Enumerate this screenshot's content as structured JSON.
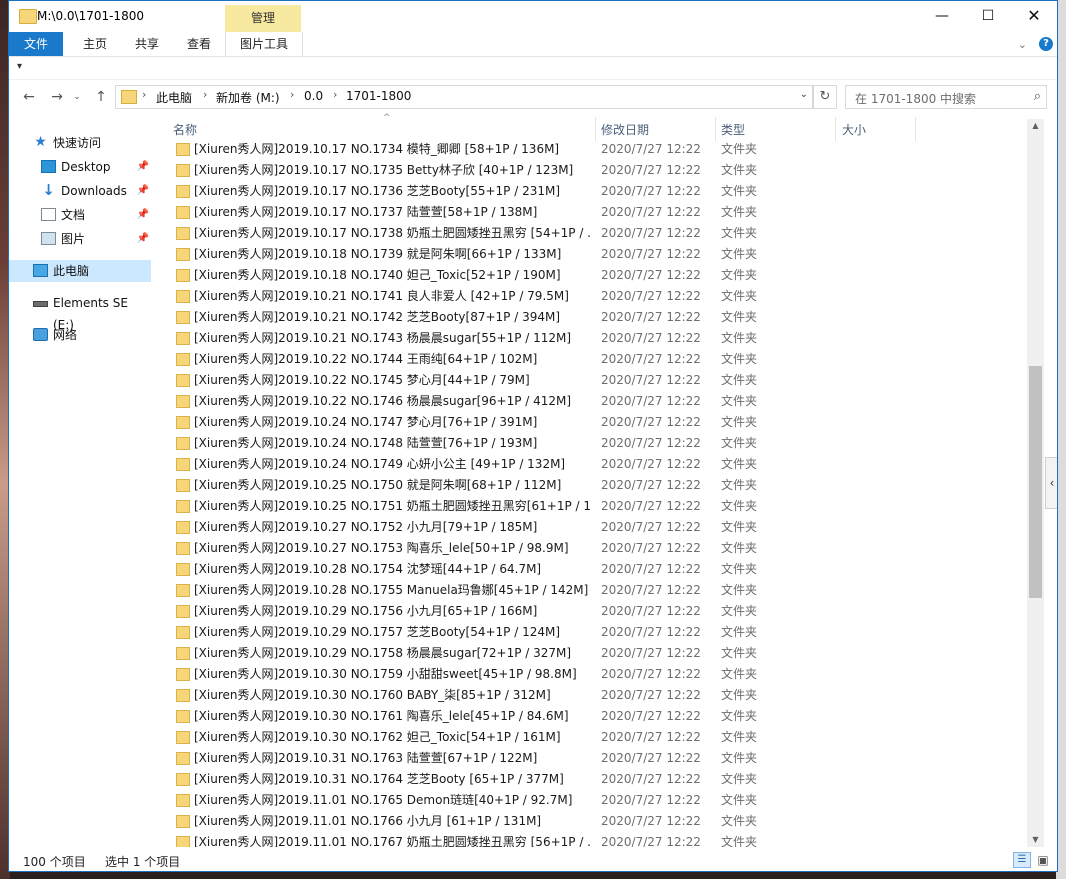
{
  "window": {
    "title": "M:\\0.0\\1701-1800",
    "manage_tab": "管理",
    "controls": {
      "minimize": "—",
      "maximize": "☐",
      "close": "✕"
    }
  },
  "ribbon": {
    "tabs": {
      "file": "文件",
      "home": "主页",
      "share": "共享",
      "view": "查看",
      "picture_tools": "图片工具"
    },
    "collapse_glyph": "⌄",
    "help": "?"
  },
  "qat": {
    "arrow": "▾"
  },
  "address": {
    "back": "←",
    "forward": "→",
    "recent": "⌄",
    "up": "↑",
    "crumbs": [
      "此电脑",
      "新加卷 (M:)",
      "0.0",
      "1701-1800"
    ],
    "separator": "›",
    "dropdown": "⌄",
    "refresh": "↻"
  },
  "search": {
    "placeholder": "在 1701-1800 中搜索",
    "icon": "search-icon"
  },
  "navpane": {
    "quick_access": "快速访问",
    "desktop": "Desktop",
    "downloads": "Downloads",
    "documents": "文档",
    "pictures": "图片",
    "this_pc": "此电脑",
    "drive": "Elements SE (E:)",
    "network": "网络",
    "pin": "📌"
  },
  "columns": {
    "name": "名称",
    "date": "修改日期",
    "type": "类型",
    "size": "大小",
    "sort_glyph": "^"
  },
  "files": [
    {
      "name": "[Xiuren秀人网]2019.10.17 NO.1734 模特_卿卿 [58+1P / 136M]",
      "date": "2020/7/27 12:22",
      "type": "文件夹"
    },
    {
      "name": "[Xiuren秀人网]2019.10.17 NO.1735 Betty林子欣 [40+1P / 123M]",
      "date": "2020/7/27 12:22",
      "type": "文件夹"
    },
    {
      "name": "[Xiuren秀人网]2019.10.17 NO.1736 芝芝Booty[55+1P / 231M]",
      "date": "2020/7/27 12:22",
      "type": "文件夹"
    },
    {
      "name": "[Xiuren秀人网]2019.10.17 NO.1737 陆萱萱[58+1P / 138M]",
      "date": "2020/7/27 12:22",
      "type": "文件夹"
    },
    {
      "name": "[Xiuren秀人网]2019.10.17 NO.1738 奶瓶土肥圆矮挫丑黑穷 [54+1P / ...",
      "date": "2020/7/27 12:22",
      "type": "文件夹"
    },
    {
      "name": "[Xiuren秀人网]2019.10.18 NO.1739 就是阿朱啊[66+1P / 133M]",
      "date": "2020/7/27 12:22",
      "type": "文件夹"
    },
    {
      "name": "[Xiuren秀人网]2019.10.18 NO.1740 妲己_Toxic[52+1P / 190M]",
      "date": "2020/7/27 12:22",
      "type": "文件夹"
    },
    {
      "name": "[Xiuren秀人网]2019.10.21 NO.1741 良人非爱人 [42+1P / 79.5M]",
      "date": "2020/7/27 12:22",
      "type": "文件夹"
    },
    {
      "name": "[Xiuren秀人网]2019.10.21 NO.1742 芝芝Booty[87+1P / 394M]",
      "date": "2020/7/27 12:22",
      "type": "文件夹"
    },
    {
      "name": "[Xiuren秀人网]2019.10.21 NO.1743 杨晨晨sugar[55+1P / 112M]",
      "date": "2020/7/27 12:22",
      "type": "文件夹"
    },
    {
      "name": "[Xiuren秀人网]2019.10.22 NO.1744 王雨纯[64+1P / 102M]",
      "date": "2020/7/27 12:22",
      "type": "文件夹"
    },
    {
      "name": "[Xiuren秀人网]2019.10.22 NO.1745 梦心月[44+1P / 79M]",
      "date": "2020/7/27 12:22",
      "type": "文件夹"
    },
    {
      "name": "[Xiuren秀人网]2019.10.22 NO.1746 杨晨晨sugar[96+1P / 412M]",
      "date": "2020/7/27 12:22",
      "type": "文件夹"
    },
    {
      "name": "[Xiuren秀人网]2019.10.24 NO.1747 梦心月[76+1P / 391M]",
      "date": "2020/7/27 12:22",
      "type": "文件夹"
    },
    {
      "name": "[Xiuren秀人网]2019.10.24 NO.1748 陆萱萱[76+1P / 193M]",
      "date": "2020/7/27 12:22",
      "type": "文件夹"
    },
    {
      "name": "[Xiuren秀人网]2019.10.24 NO.1749 心妍小公主 [49+1P / 132M]",
      "date": "2020/7/27 12:22",
      "type": "文件夹"
    },
    {
      "name": "[Xiuren秀人网]2019.10.25 NO.1750 就是阿朱啊[68+1P / 112M]",
      "date": "2020/7/27 12:22",
      "type": "文件夹"
    },
    {
      "name": "[Xiuren秀人网]2019.10.25 NO.1751 奶瓶土肥圆矮挫丑黑穷[61+1P / 1...",
      "date": "2020/7/27 12:22",
      "type": "文件夹"
    },
    {
      "name": "[Xiuren秀人网]2019.10.27 NO.1752 小九月[79+1P / 185M]",
      "date": "2020/7/27 12:22",
      "type": "文件夹"
    },
    {
      "name": "[Xiuren秀人网]2019.10.27 NO.1753 陶喜乐_lele[50+1P / 98.9M]",
      "date": "2020/7/27 12:22",
      "type": "文件夹"
    },
    {
      "name": "[Xiuren秀人网]2019.10.28 NO.1754 沈梦瑶[44+1P / 64.7M]",
      "date": "2020/7/27 12:22",
      "type": "文件夹"
    },
    {
      "name": "[Xiuren秀人网]2019.10.28 NO.1755 Manuela玛鲁娜[45+1P / 142M]",
      "date": "2020/7/27 12:22",
      "type": "文件夹"
    },
    {
      "name": "[Xiuren秀人网]2019.10.29 NO.1756 小九月[65+1P / 166M]",
      "date": "2020/7/27 12:22",
      "type": "文件夹"
    },
    {
      "name": "[Xiuren秀人网]2019.10.29 NO.1757 芝芝Booty[54+1P / 124M]",
      "date": "2020/7/27 12:22",
      "type": "文件夹"
    },
    {
      "name": "[Xiuren秀人网]2019.10.29 NO.1758 杨晨晨sugar[72+1P / 327M]",
      "date": "2020/7/27 12:22",
      "type": "文件夹"
    },
    {
      "name": "[Xiuren秀人网]2019.10.30 NO.1759 小甜甜sweet[45+1P / 98.8M]",
      "date": "2020/7/27 12:22",
      "type": "文件夹"
    },
    {
      "name": "[Xiuren秀人网]2019.10.30 NO.1760 BABY_柒[85+1P / 312M]",
      "date": "2020/7/27 12:22",
      "type": "文件夹"
    },
    {
      "name": "[Xiuren秀人网]2019.10.30 NO.1761 陶喜乐_lele[45+1P / 84.6M]",
      "date": "2020/7/27 12:22",
      "type": "文件夹"
    },
    {
      "name": "[Xiuren秀人网]2019.10.30 NO.1762 妲己_Toxic[54+1P / 161M]",
      "date": "2020/7/27 12:22",
      "type": "文件夹"
    },
    {
      "name": "[Xiuren秀人网]2019.10.31 NO.1763 陆萱萱[67+1P / 122M]",
      "date": "2020/7/27 12:22",
      "type": "文件夹"
    },
    {
      "name": "[Xiuren秀人网]2019.10.31 NO.1764 芝芝Booty [65+1P / 377M]",
      "date": "2020/7/27 12:22",
      "type": "文件夹"
    },
    {
      "name": "[Xiuren秀人网]2019.11.01 NO.1765 Demon琏琏[40+1P / 92.7M]",
      "date": "2020/7/27 12:22",
      "type": "文件夹"
    },
    {
      "name": "[Xiuren秀人网]2019.11.01 NO.1766 小九月 [61+1P / 131M]",
      "date": "2020/7/27 12:22",
      "type": "文件夹"
    },
    {
      "name": "[Xiuren秀人网]2019.11.01 NO.1767 奶瓶土肥圆矮挫丑黑穷 [56+1P / ...",
      "date": "2020/7/27 12:22",
      "type": "文件夹"
    }
  ],
  "scrollbar": {
    "up": "▲",
    "down": "▼"
  },
  "side_collapse": "‹",
  "status": {
    "count": "100 个项目",
    "selected": "选中 1 个项目"
  },
  "views": {
    "details": "☰",
    "large": "▣"
  },
  "colors": {
    "accent": "#1979ca",
    "manage_tab": "#f8e9a0",
    "folder": "#f7d67a",
    "nav_selected": "#cce8ff"
  }
}
